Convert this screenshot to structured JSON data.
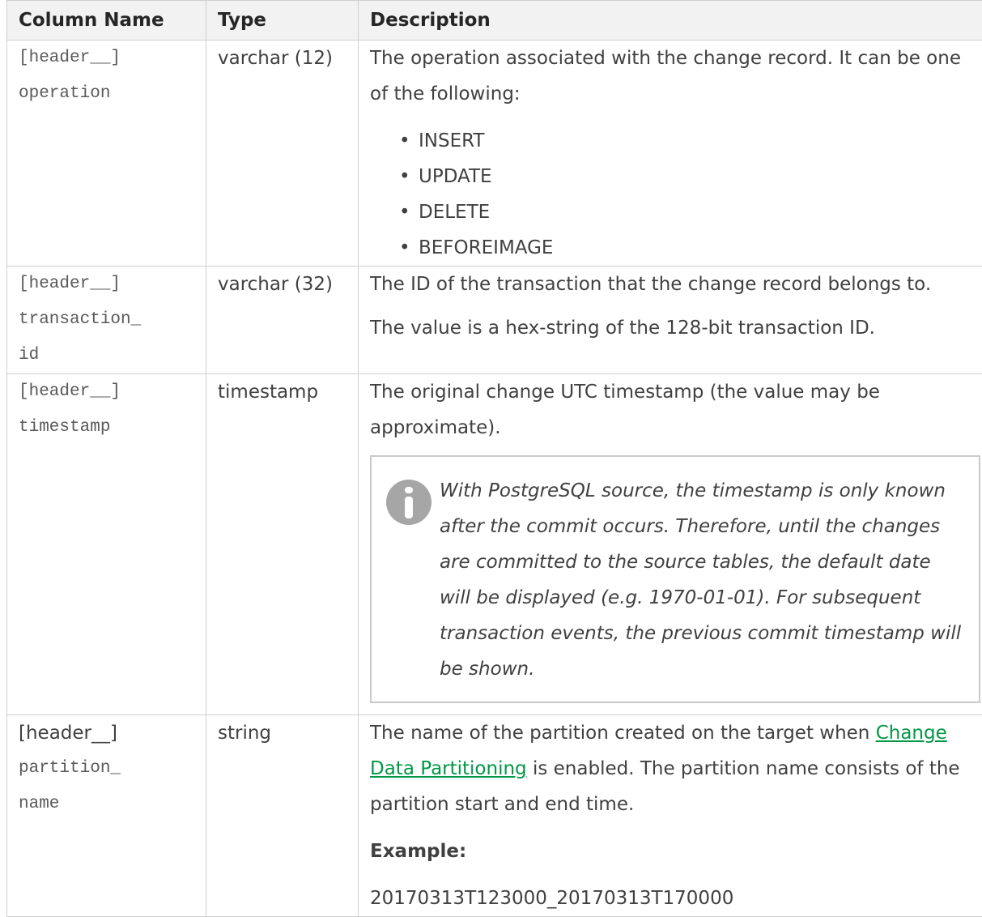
{
  "table": {
    "headers": [
      "Column Name",
      "Type",
      "Description"
    ],
    "rows": [
      {
        "name_lines": [
          "[header__]",
          "operation"
        ],
        "type": "varchar (12)",
        "desc": "The operation associated with the change record. It can be one of the following:",
        "list": [
          "INSERT",
          "UPDATE",
          "DELETE",
          "BEFOREIMAGE"
        ]
      },
      {
        "name_lines": [
          "[header__]",
          "transaction_",
          "id"
        ],
        "type": "varchar (32)",
        "desc1": "The ID of the transaction that the change record belongs to.",
        "desc2": "The value is a hex-string of the 128-bit transaction ID."
      },
      {
        "name_lines": [
          "[header__]",
          "timestamp"
        ],
        "type": "timestamp",
        "desc": "The original change UTC timestamp (the value may be approximate).",
        "note": "With PostgreSQL source, the timestamp is only known after the commit occurs. Therefore, until the changes are committed to the source tables, the default date will be displayed (e.g. 1970-01-01). For subsequent transaction events, the previous commit timestamp will be shown.",
        "note_icon": "info-icon"
      },
      {
        "name_first": "[header__]",
        "name_lines": [
          "partition_",
          "name"
        ],
        "type": "string",
        "desc_before": "The name of the partition created on the target when ",
        "link": "Change Data Partitioning",
        "desc_after": " is enabled. The partition name consists of the partition start and end time.",
        "example_label": "Example:",
        "example_value": "20170313T123000_20170313T170000"
      }
    ]
  },
  "colors": {
    "link": "#009845",
    "header_bg": "#f2f2f2",
    "border": "#d0d0d0",
    "icon": "#a6a6a6"
  }
}
